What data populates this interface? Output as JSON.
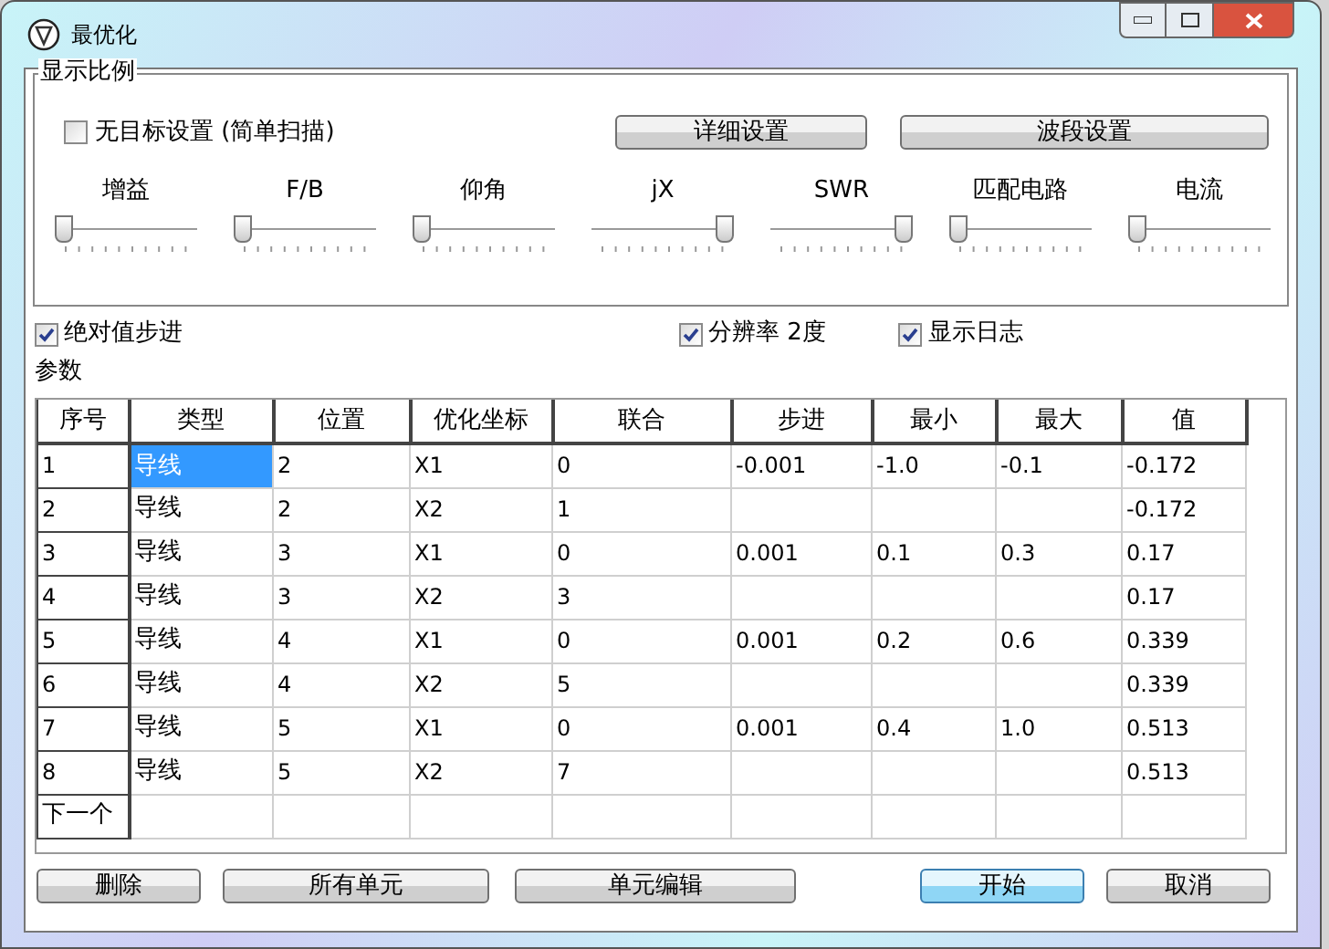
{
  "window": {
    "title": "最优化"
  },
  "group": {
    "title": "显示比例"
  },
  "no_target": {
    "label": "无目标设置 (简单扫描)",
    "checked": false
  },
  "top_buttons": [
    "详细设置",
    "波段设置"
  ],
  "sliders": [
    {
      "label": "增益",
      "level": 0
    },
    {
      "label": "F/B",
      "level": 0
    },
    {
      "label": "仰角",
      "level": 0
    },
    {
      "label": "jX",
      "level": 1
    },
    {
      "label": "SWR",
      "level": 1
    },
    {
      "label": "匹配电路",
      "level": 0
    },
    {
      "label": "电流",
      "level": 0
    }
  ],
  "options": [
    {
      "label": "绝对值步进",
      "checked": true
    },
    {
      "label": "分辨率 2度",
      "checked": true
    },
    {
      "label": "显示日志",
      "checked": true
    }
  ],
  "params_label": "参数",
  "table": {
    "columns": [
      "序号",
      "类型",
      "位置",
      "优化坐标",
      "联合",
      "步进",
      "最小",
      "最大",
      "值"
    ],
    "rows": [
      {
        "cells": [
          "1",
          "导线",
          "2",
          "X1",
          "0",
          "-0.001",
          "-1.0",
          "-0.1",
          "-0.172"
        ],
        "selected": true
      },
      {
        "cells": [
          "2",
          "导线",
          "2",
          "X2",
          "1",
          "",
          "",
          "",
          "-0.172"
        ],
        "selected": false
      },
      {
        "cells": [
          "3",
          "导线",
          "3",
          "X1",
          "0",
          "0.001",
          "0.1",
          "0.3",
          "0.17"
        ],
        "selected": false
      },
      {
        "cells": [
          "4",
          "导线",
          "3",
          "X2",
          "3",
          "",
          "",
          "",
          "0.17"
        ],
        "selected": false
      },
      {
        "cells": [
          "5",
          "导线",
          "4",
          "X1",
          "0",
          "0.001",
          "0.2",
          "0.6",
          "0.339"
        ],
        "selected": false
      },
      {
        "cells": [
          "6",
          "导线",
          "4",
          "X2",
          "5",
          "",
          "",
          "",
          "0.339"
        ],
        "selected": false
      },
      {
        "cells": [
          "7",
          "导线",
          "5",
          "X1",
          "0",
          "0.001",
          "0.4",
          "1.0",
          "0.513"
        ],
        "selected": false
      },
      {
        "cells": [
          "8",
          "导线",
          "5",
          "X2",
          "7",
          "",
          "",
          "",
          "0.513"
        ],
        "selected": false
      }
    ],
    "new_row": "下一个"
  },
  "bottom_buttons": [
    {
      "label": "删除",
      "default": false
    },
    {
      "label": "所有单元",
      "default": false
    },
    {
      "label": "单元编辑",
      "default": false
    },
    {
      "label": "开始",
      "default": true
    },
    {
      "label": "取消",
      "default": false
    }
  ]
}
